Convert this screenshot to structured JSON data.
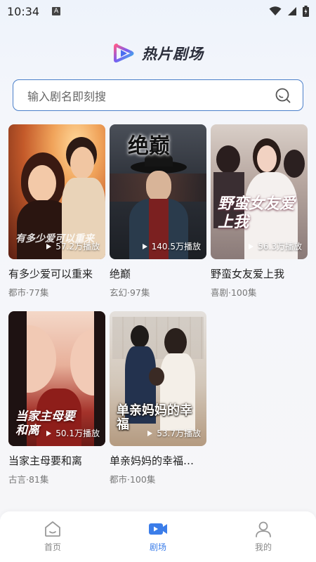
{
  "status_bar": {
    "time": "10:34",
    "notification_badge": "A"
  },
  "header": {
    "title": "热片剧场"
  },
  "search": {
    "placeholder": "输入剧名即刻搜"
  },
  "dramas": [
    {
      "title": "有多少爱可以重来",
      "meta": "都市·77集",
      "plays": "57.2万播放",
      "poster_text": "有多少爱可以重来"
    },
    {
      "title": "绝巅",
      "meta": "玄幻·97集",
      "plays": "140.5万播放",
      "poster_text": "绝巅"
    },
    {
      "title": "野蛮女友爱上我",
      "meta": "喜剧·100集",
      "plays": "56.3万播放",
      "poster_text": "野蛮女友爱上我"
    },
    {
      "title": "当家主母要和离",
      "meta": "古言·81集",
      "plays": "50.1万播放",
      "poster_text": "当家主母要和离"
    },
    {
      "title": "单亲妈妈的幸福…",
      "meta": "都市·100集",
      "plays": "53.7万播放",
      "poster_text": "单亲妈妈的幸福"
    }
  ],
  "tabs": [
    {
      "label": "首页",
      "icon": "home-icon",
      "active": false
    },
    {
      "label": "剧场",
      "icon": "video-icon",
      "active": true
    },
    {
      "label": "我的",
      "icon": "user-icon",
      "active": false
    }
  ],
  "colors": {
    "accent": "#3b7de9",
    "search_border": "#4a7fc9"
  }
}
